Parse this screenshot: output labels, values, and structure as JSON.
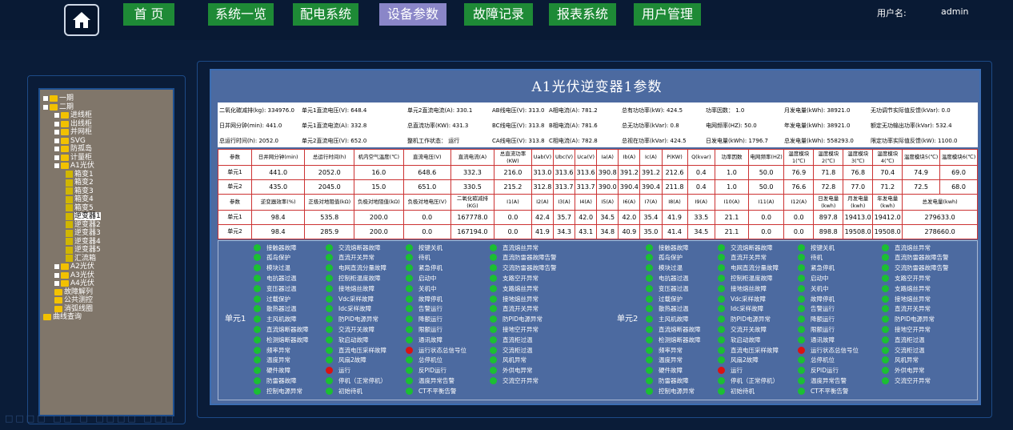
{
  "nav": {
    "items": [
      {
        "label": "首 页",
        "active": false
      },
      {
        "label": "系统一览",
        "active": false
      },
      {
        "label": "配电系统",
        "active": false
      },
      {
        "label": "设备参数",
        "active": true
      },
      {
        "label": "故障记录",
        "active": false
      },
      {
        "label": "报表系统",
        "active": false
      },
      {
        "label": "用户管理",
        "active": false
      }
    ],
    "user_label": "用户名:",
    "user_name": "admin"
  },
  "tree": [
    {
      "label": "一期",
      "indent": 0,
      "type": "folder",
      "exp": true
    },
    {
      "label": "二期",
      "indent": 0,
      "type": "folder",
      "exp": true
    },
    {
      "label": "进线柜",
      "indent": 1,
      "type": "folder",
      "exp": true
    },
    {
      "label": "出线柜",
      "indent": 1,
      "type": "folder",
      "exp": true
    },
    {
      "label": "并网柜",
      "indent": 1,
      "type": "folder",
      "exp": true
    },
    {
      "label": "SVG",
      "indent": 1,
      "type": "folder",
      "exp": true
    },
    {
      "label": "防孤岛",
      "indent": 1,
      "type": "folder",
      "exp": true
    },
    {
      "label": "计量柜",
      "indent": 1,
      "type": "folder",
      "exp": true
    },
    {
      "label": "A1光伏",
      "indent": 1,
      "type": "folder",
      "exp": true
    },
    {
      "label": "箱变1",
      "indent": 2,
      "type": "leaf"
    },
    {
      "label": "箱变2",
      "indent": 2,
      "type": "leaf"
    },
    {
      "label": "箱变3",
      "indent": 2,
      "type": "leaf"
    },
    {
      "label": "箱变4",
      "indent": 2,
      "type": "leaf"
    },
    {
      "label": "箱变5",
      "indent": 2,
      "type": "leaf"
    },
    {
      "label": "逆变器1",
      "indent": 2,
      "type": "leaf",
      "selected": true
    },
    {
      "label": "逆变器2",
      "indent": 2,
      "type": "leaf"
    },
    {
      "label": "逆变器3",
      "indent": 2,
      "type": "leaf"
    },
    {
      "label": "逆变器4",
      "indent": 2,
      "type": "leaf"
    },
    {
      "label": "逆变器5",
      "indent": 2,
      "type": "leaf"
    },
    {
      "label": "汇流箱",
      "indent": 2,
      "type": "leaf"
    },
    {
      "label": "A2光伏",
      "indent": 1,
      "type": "folder",
      "exp": true
    },
    {
      "label": "A3光伏",
      "indent": 1,
      "type": "folder",
      "exp": true
    },
    {
      "label": "A4光伏",
      "indent": 1,
      "type": "folder",
      "exp": true
    },
    {
      "label": "故障解列",
      "indent": 1,
      "type": "folder"
    },
    {
      "label": "公共测控",
      "indent": 1,
      "type": "folder"
    },
    {
      "label": "消弧线圈",
      "indent": 1,
      "type": "folder"
    },
    {
      "label": "曲线查询",
      "indent": 0,
      "type": "folder"
    }
  ],
  "panel": {
    "title": "A1光伏逆变器1参数"
  },
  "params": [
    [
      "二氧化碳减排(kg): 334976.0",
      "单元1直流电压(V): 648.4",
      "单元2直流电流(A): 330.1",
      "AB线电压(V): 313.0",
      "A相电流(A): 781.2",
      "总有功功率(kW): 424.5",
      "功率因数：  1.0",
      "月发电量(kWh): 38921.0",
      "无功调节实际值反馈(kVar): 0.0"
    ],
    [
      "日并网分钟(min): 441.0",
      "单元1直流电流(A): 332.8",
      "总直流功率(KW): 431.3",
      "BC线电压(V): 313.8",
      "B相电流(A): 781.6",
      "总无功功率(kVar): 0.8",
      "电网频率(HZ):  50.0",
      "年发电量(kWh): 38921.0",
      "额定无功输出功率(kVar):  532.4"
    ],
    [
      "总运行时间(h):  2052.0",
      "单元2直流电压(V): 652.0",
      "整机工作状态：  运行",
      "CA线电压(V): 313.8",
      "C相电流(A): 782.8",
      "总视在功率(kVar): 424.5",
      "日发电量(kWh): 1796.7",
      "总发电量(kWh): 558293.0",
      "限定功率实际值反馈(kW): 1100.0"
    ]
  ],
  "grid": {
    "head1": [
      "参数",
      "日并网分钟(min)",
      "总运行时间(h)",
      "机内空气温度(℃)",
      "直流电压(V)",
      "直流电流(A)",
      "总直流功率(KW)",
      "Uab(V)",
      "Ubc(V)",
      "Uca(V)",
      "Ia(A)",
      "Ib(A)",
      "Ic(A)",
      "P(KW)",
      "Q(kvar)",
      "功率因数",
      "电网频率(HZ)",
      "温度模块1(℃)",
      "温度模块2(℃)",
      "温度模块3(℃)",
      "温度模块4(℃)",
      "温度模块5(℃)",
      "温度模块6(℃)"
    ],
    "r1": [
      "单元1",
      "441.0",
      "2052.0",
      "16.0",
      "648.6",
      "332.3",
      "216.0",
      "313.0",
      "313.6",
      "313.6",
      "390.8",
      "391.2",
      "391.2",
      "212.6",
      "0.4",
      "1.0",
      "50.0",
      "76.9",
      "71.8",
      "76.8",
      "70.4",
      "74.9",
      "69.0"
    ],
    "r2": [
      "单元2",
      "435.0",
      "2045.0",
      "15.0",
      "651.0",
      "330.5",
      "215.2",
      "312.8",
      "313.7",
      "313.7",
      "390.0",
      "390.4",
      "390.4",
      "211.8",
      "0.4",
      "1.0",
      "50.0",
      "76.6",
      "72.8",
      "77.0",
      "71.2",
      "72.5",
      "68.0"
    ],
    "head2": [
      "参数",
      "逆变器效率(%)",
      "正极对地阻值(kΩ)",
      "负极对地阻值(kΩ)",
      "负极对地电压(V)",
      "二氧化碳减排(KG)",
      "I1(A)",
      "I2(A)",
      "I3(A)",
      "I4(A)",
      "I5(A)",
      "I6(A)",
      "I7(A)",
      "I8(A)",
      "I9(A)",
      "I10(A)",
      "I11(A)",
      "I12(A)",
      "日发电量(kwh)",
      "月发电量(kwh)",
      "年发电量(kwh)",
      "总发电量(kwh)"
    ],
    "r3": [
      "单元1",
      "98.4",
      "535.8",
      "200.0",
      "0.0",
      "167778.0",
      "0.0",
      "42.4",
      "35.7",
      "42.0",
      "34.5",
      "42.0",
      "35.4",
      "41.9",
      "33.5",
      "21.1",
      "0.0",
      "0.0",
      "897.8",
      "19413.0",
      "19412.0",
      "279633.0"
    ],
    "r4": [
      "单元2",
      "98.4",
      "285.9",
      "200.0",
      "0.0",
      "167194.0",
      "0.0",
      "41.9",
      "34.3",
      "43.1",
      "34.8",
      "40.9",
      "35.0",
      "41.4",
      "34.5",
      "21.1",
      "0.0",
      "0.0",
      "898.8",
      "19508.0",
      "19508.0",
      "278660.0"
    ]
  },
  "alarm_units": [
    "单元1",
    "单元2"
  ],
  "alarm_cols": [
    [
      "接触器故障",
      "孤岛保护",
      "模块过温",
      "电抗器过温",
      "变压器过温",
      "过载保护",
      "散热器过温",
      "主风机故障",
      "直流熔断器故障",
      "检测熔断器故障",
      "频率异常",
      "温度异常",
      "硬件故障",
      "防雷器故障",
      "控制电源异常"
    ],
    [
      "交流熔断器故障",
      "直流开关异常",
      "电网直流分量故障",
      "控制柜温度故障",
      "接地熔丝故障",
      "Vdc采样故障",
      "Idc采样故障",
      "防PID电源异常",
      "交流开关故障",
      "软启动故障",
      "直流电压采样故障",
      "风扇2故障",
      "运行",
      "停机（正常停机）",
      "初始待机"
    ],
    [
      "按键关机",
      "待机",
      "紧急停机",
      "启动中",
      "关机中",
      "故障停机",
      "告警运行",
      "降额运行",
      "限额运行",
      "通讯故障",
      "运行状态总信号位",
      "总停机位",
      "反PID运行",
      "温度异常告警",
      "CT不平衡告警"
    ],
    [
      "直流熔丝异常",
      "直流防雷器故障告警",
      "交流防雷器故障告警",
      "支路空开异常",
      "支路熔丝异常",
      "接地熔丝异常",
      "直流开关异常",
      "防PID电源异常",
      "接地空开异常",
      "直流柜过温",
      "交流柜过温",
      "风机异常",
      "外供电异常",
      "交流空开异常"
    ]
  ],
  "red_alarms": {
    "1": [
      12
    ],
    "2": [
      10
    ]
  },
  "bottom_text": "□□□□ □□ □ □□□□ □□□"
}
